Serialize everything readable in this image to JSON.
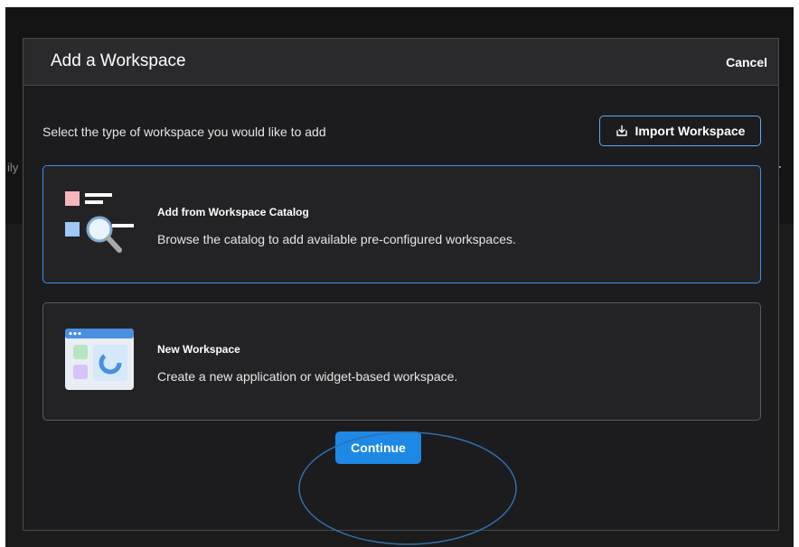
{
  "backdrop": {
    "fragment_text": "ily"
  },
  "dialog": {
    "title": "Add a Workspace",
    "cancel_label": "Cancel",
    "instruction": "Select the type of workspace you would like to add",
    "import_label": "Import Workspace",
    "options": [
      {
        "title": "Add from Workspace Catalog",
        "description": "Browse the catalog to add available pre-configured workspaces.",
        "icon": "catalog-search-icon",
        "selected": true
      },
      {
        "title": "New Workspace",
        "description": "Create a new application or widget-based workspace.",
        "icon": "new-workspace-icon",
        "selected": false
      }
    ],
    "continue_label": "Continue"
  },
  "colors": {
    "accent": "#1e88e5",
    "selected_border": "#3f8ee8",
    "dialog_bg": "#1c1c1e",
    "header_bg": "#2a2a2c",
    "annotation": "#2f6fb0"
  }
}
